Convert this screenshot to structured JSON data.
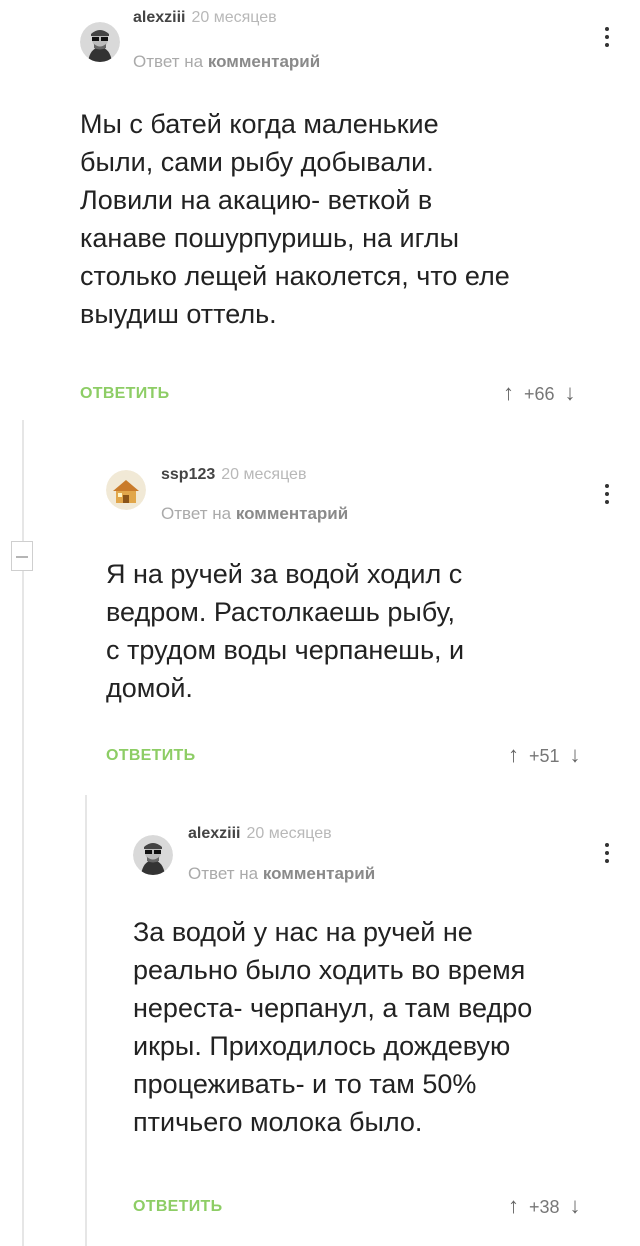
{
  "thread": {
    "comments": [
      {
        "author": "alexziii",
        "time": "20 месяцев",
        "reply_prefix": "Ответ на",
        "reply_target": "комментарий",
        "lines": [
          "Мы с батей когда маленькие",
          "были, сами рыбу добывали.",
          "Ловили на акацию- веткой в",
          "канаве пошурпуришь, на иглы",
          "столько лещей наколется, что еле",
          "выудиш оттель."
        ],
        "reply_label": "ОТВЕТИТЬ",
        "rating": "+66",
        "avatar_icon": "glasses-avatar-icon"
      },
      {
        "author": "ssp123",
        "time": "20 месяцев",
        "reply_prefix": "Ответ на",
        "reply_target": "комментарий",
        "lines": [
          "Я на ручей за водой ходил с",
          "ведром. Растолкаешь рыбу,",
          "с трудом воды черпанешь, и",
          "домой."
        ],
        "reply_label": "ОТВЕТИТЬ",
        "rating": "+51",
        "avatar_icon": "house-avatar-icon"
      },
      {
        "author": "alexziii",
        "time": "20 месяцев",
        "reply_prefix": "Ответ на",
        "reply_target": "комментарий",
        "lines": [
          "За водой у нас на ручей не",
          "реально было ходить во время",
          "нереста- черпанул, а там ведро",
          "икры. Приходилось дождевую",
          "процеживать- и то там 50%",
          "птичьего молока было."
        ],
        "reply_label": "ОТВЕТИТЬ",
        "rating": "+38",
        "avatar_icon": "glasses-avatar-icon"
      }
    ]
  },
  "colors": {
    "reply_link": "#8dcd65",
    "muted": "#aaaaaa",
    "thread_line": "#e6e6e6"
  },
  "icons": {
    "upvote": "arrow-up-icon",
    "downvote": "arrow-down-icon",
    "menu": "more-vertical-icon",
    "collapse": "collapse-minus-icon"
  }
}
